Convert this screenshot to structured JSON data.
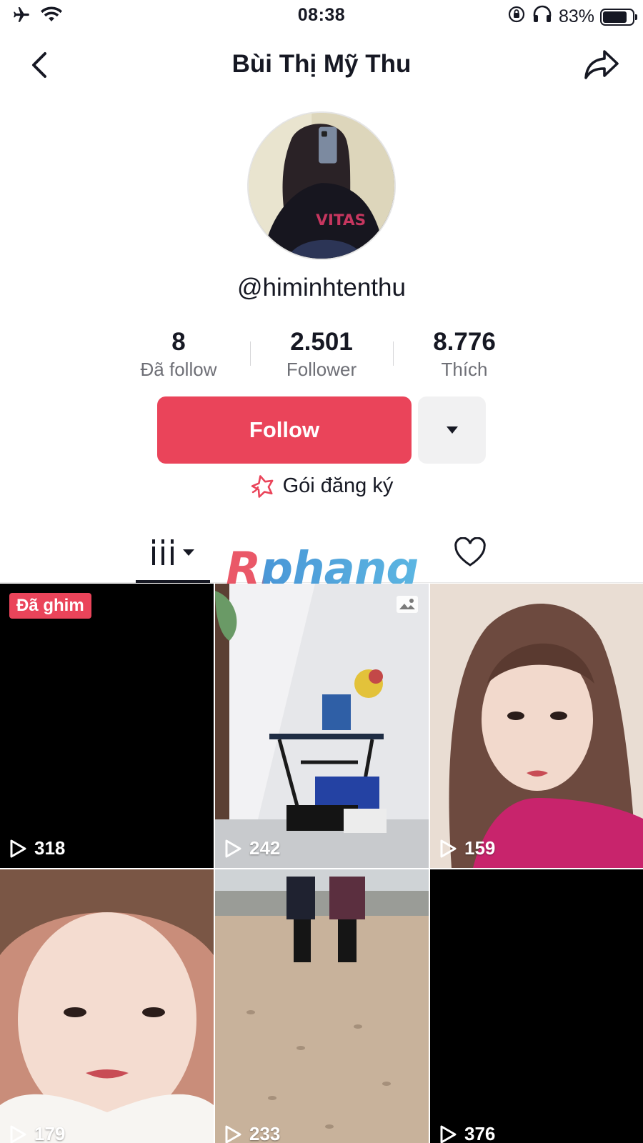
{
  "status_bar": {
    "time": "08:38",
    "battery_text": "83%",
    "battery_level": 0.83,
    "icons": [
      "airplane-icon",
      "wifi-icon",
      "orientation-lock-icon",
      "headphones-icon",
      "battery-icon"
    ]
  },
  "header": {
    "title": "Bùi Thị Mỹ Thu",
    "back_icon": "back-chevron-icon",
    "share_icon": "share-arrow-icon"
  },
  "profile": {
    "username": "@himinhtenthu",
    "stats": [
      {
        "value": "8",
        "label": "Đã follow"
      },
      {
        "value": "2.501",
        "label": "Follower"
      },
      {
        "value": "8.776",
        "label": "Thích"
      }
    ],
    "follow_label": "Follow",
    "subscribe_label": "Gói đăng ký"
  },
  "tabs": {
    "videos_icon": "grid-lines-icon",
    "liked_icon": "heart-icon"
  },
  "watermark": "Rphang",
  "videos": [
    {
      "views": "318",
      "pinned_label": "Đã ghim"
    },
    {
      "views": "242",
      "photo": true
    },
    {
      "views": "159"
    },
    {
      "views": "179"
    },
    {
      "views": "233"
    },
    {
      "views": "376"
    }
  ],
  "colors": {
    "accent": "#ea445a",
    "text": "#161823",
    "muted": "#6e6f76"
  }
}
